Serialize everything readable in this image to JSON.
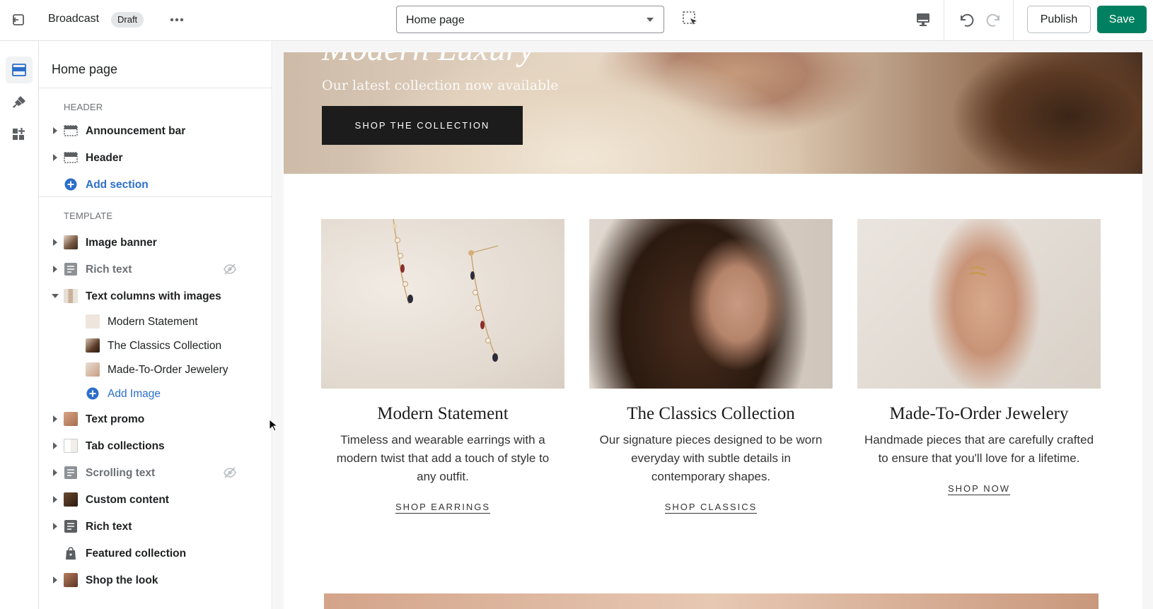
{
  "topbar": {
    "theme_name": "Broadcast",
    "status_badge": "Draft",
    "page_selector": "Home page",
    "publish_label": "Publish",
    "save_label": "Save"
  },
  "colors": {
    "accent_green": "#008060",
    "link_blue": "#2c6ecb"
  },
  "rail": {
    "items": [
      "sections-icon",
      "theme-settings-icon",
      "app-blocks-icon"
    ]
  },
  "sidebar": {
    "title": "Home page",
    "header_label": "HEADER",
    "header_items": [
      {
        "label": "Announcement bar",
        "icon": "announcement-bar-icon"
      },
      {
        "label": "Header",
        "icon": "header-icon"
      }
    ],
    "add_section": "Add section",
    "template_label": "TEMPLATE",
    "template_items": [
      {
        "label": "Image banner",
        "icon": "image-banner-thumb"
      },
      {
        "label": "Rich text",
        "icon": "rich-text-icon",
        "hidden": true
      },
      {
        "label": "Text columns with images",
        "icon": "text-columns-thumb",
        "expanded": true
      },
      {
        "label": "Text promo",
        "icon": "text-promo-thumb"
      },
      {
        "label": "Tab collections",
        "icon": "tab-collections-thumb"
      },
      {
        "label": "Scrolling text",
        "icon": "scrolling-text-icon",
        "hidden": true
      },
      {
        "label": "Custom content",
        "icon": "custom-content-thumb"
      },
      {
        "label": "Rich text",
        "icon": "rich-text-icon"
      },
      {
        "label": "Featured collection",
        "icon": "tag-icon"
      },
      {
        "label": "Shop the look",
        "icon": "shop-the-look-thumb"
      }
    ],
    "children": [
      {
        "label": "Modern Statement"
      },
      {
        "label": "The Classics Collection"
      },
      {
        "label": "Made-To-Order Jewelery"
      }
    ],
    "add_image": "Add Image"
  },
  "preview": {
    "hero": {
      "heading": "Modern Luxury",
      "subheading": "Our latest collection now available",
      "button": "SHOP THE COLLECTION"
    },
    "columns": [
      {
        "title": "Modern Statement",
        "description": "Timeless and wearable earrings with a modern twist that add a touch of style to any outfit.",
        "link": "SHOP EARRINGS"
      },
      {
        "title": "The Classics Collection",
        "description": "Our signature pieces designed to be worn everyday with subtle details in contemporary shapes.",
        "link": "SHOP CLASSICS"
      },
      {
        "title": "Made-To-Order Jewelery",
        "description": "Handmade pieces that are carefully crafted to ensure that you'll love for a lifetime.",
        "link": "SHOP NOW"
      }
    ]
  }
}
